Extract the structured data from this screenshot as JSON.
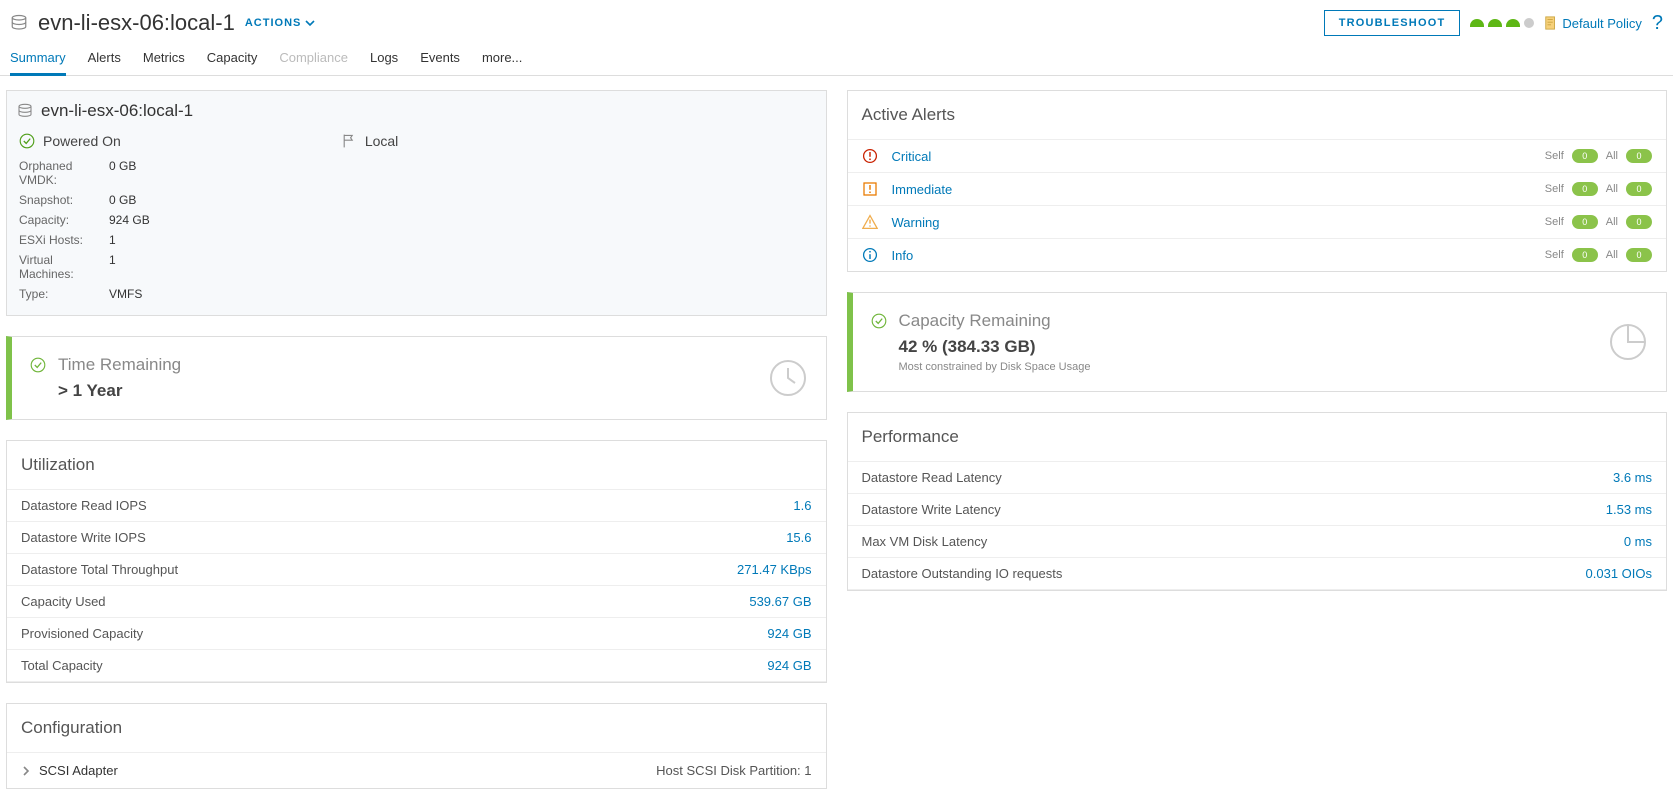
{
  "header": {
    "title": "evn-li-esx-06:local-1",
    "actions": "ACTIONS",
    "troubleshoot": "TROUBLESHOOT",
    "policy": "Default Policy",
    "help": "?"
  },
  "tabs": [
    "Summary",
    "Alerts",
    "Metrics",
    "Capacity",
    "Compliance",
    "Logs",
    "Events",
    "more..."
  ],
  "overview": {
    "name": "evn-li-esx-06:local-1",
    "status": "Powered On",
    "locality": "Local",
    "props": {
      "orphaned_vmdk_label": "Orphaned VMDK:",
      "orphaned_vmdk": "0 GB",
      "snapshot_label": "Snapshot:",
      "snapshot": "0 GB",
      "capacity_label": "Capacity:",
      "capacity": "924 GB",
      "hosts_label": "ESXi Hosts:",
      "hosts": "1",
      "vms_label": "Virtual Machines:",
      "vms": "1",
      "type_label": "Type:",
      "type": "VMFS"
    }
  },
  "time_remaining": {
    "title": "Time Remaining",
    "value": "> 1 Year"
  },
  "capacity_remaining": {
    "title": "Capacity Remaining",
    "value": "42 % (384.33 GB)",
    "sub": "Most constrained by Disk Space Usage"
  },
  "utilization": {
    "title": "Utilization",
    "rows": [
      {
        "label": "Datastore Read IOPS",
        "value": "1.6"
      },
      {
        "label": "Datastore Write IOPS",
        "value": "15.6"
      },
      {
        "label": "Datastore Total Throughput",
        "value": "271.47 KBps"
      },
      {
        "label": "Capacity Used",
        "value": "539.67 GB"
      },
      {
        "label": "Provisioned Capacity",
        "value": "924 GB"
      },
      {
        "label": "Total Capacity",
        "value": "924 GB"
      }
    ]
  },
  "performance": {
    "title": "Performance",
    "rows": [
      {
        "label": "Datastore Read Latency",
        "value": "3.6 ms"
      },
      {
        "label": "Datastore Write Latency",
        "value": "1.53 ms"
      },
      {
        "label": "Max VM Disk Latency",
        "value": "0 ms"
      },
      {
        "label": "Datastore Outstanding IO requests",
        "value": "0.031 OIOs"
      }
    ]
  },
  "alerts": {
    "title": "Active Alerts",
    "self_label": "Self",
    "all_label": "All",
    "severities": [
      {
        "name": "Critical",
        "self": "0",
        "all": "0",
        "color": "#c92100"
      },
      {
        "name": "Immediate",
        "self": "0",
        "all": "0",
        "color": "#e97b00"
      },
      {
        "name": "Warning",
        "self": "0",
        "all": "0",
        "color": "#f0ad4e"
      },
      {
        "name": "Info",
        "self": "0",
        "all": "0",
        "color": "#0079b8"
      }
    ]
  },
  "configuration": {
    "title": "Configuration",
    "row_label": "SCSI Adapter",
    "row_right": "Host SCSI Disk Partition: 1"
  }
}
